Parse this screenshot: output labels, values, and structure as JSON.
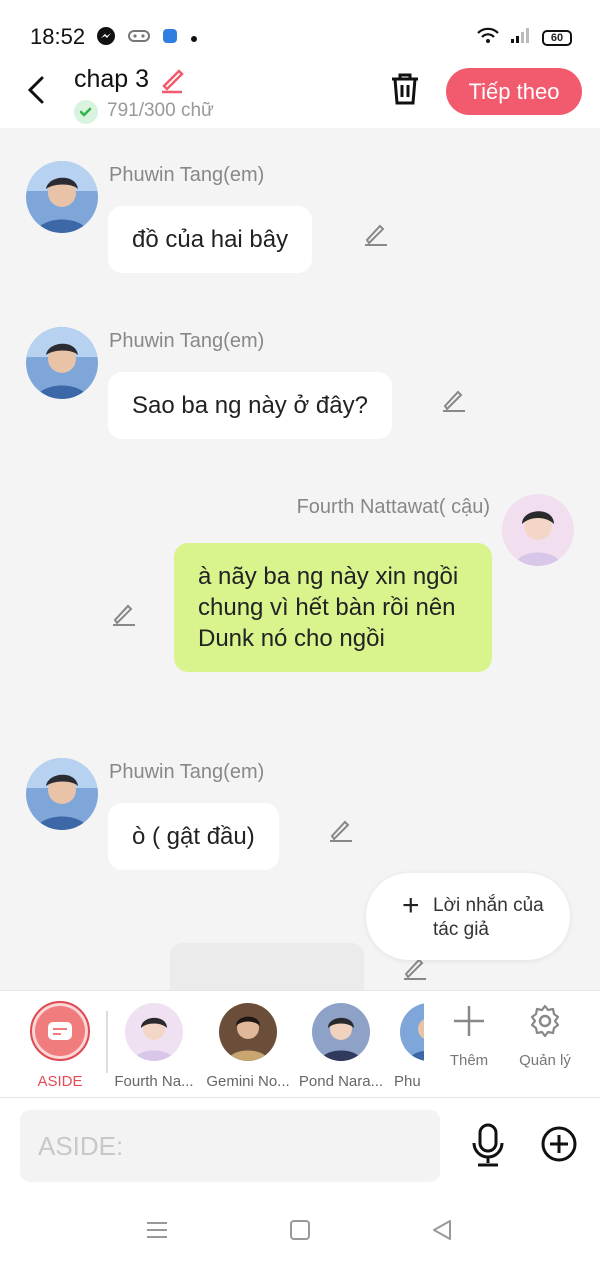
{
  "status_bar": {
    "time": "18:52",
    "battery": "60"
  },
  "header": {
    "title": "chap 3",
    "word_count": "791/300 chữ",
    "next_label": "Tiếp theo"
  },
  "messages": [
    {
      "name": "Phuwin Tang(em)",
      "text": "đồ của hai bây"
    },
    {
      "name": "Phuwin Tang(em)",
      "text": "Sao ba ng này ở đây?"
    },
    {
      "name": "Fourth Nattawat( cậu)",
      "text": "à nãy ba ng này xin ngồi chung vì hết bàn rồi nên Dunk nó cho ngồi"
    },
    {
      "name": "Phuwin Tang(em)",
      "text": "ò ( gật đầu)"
    }
  ],
  "author_note": {
    "label": "Lời nhắn của tác giả"
  },
  "characters": {
    "aside_label": "ASIDE",
    "items": [
      {
        "name": "Fourth Na..."
      },
      {
        "name": "Gemini No..."
      },
      {
        "name": "Pond Nara..."
      },
      {
        "name": "Phu"
      }
    ],
    "add_label": "Thêm",
    "manage_label": "Quản lý"
  },
  "composer": {
    "placeholder": "ASIDE:"
  },
  "colors": {
    "accent": "#f25a6e",
    "right_bubble": "#d9f38d",
    "aside": "#e24b57"
  }
}
